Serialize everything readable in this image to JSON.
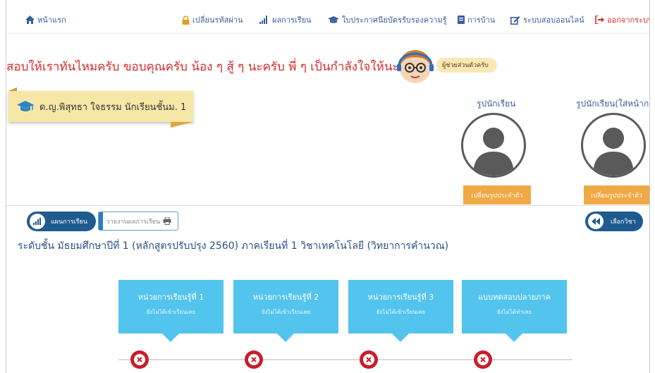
{
  "nav": {
    "home": "หน้าแรก",
    "change_password": "เปลี่ยนรหัสผ่าน",
    "results": "ผลการเรียน",
    "certificate": "ใบประกาศนียบัตรรับรองความรู้",
    "homework": "การบ้าน",
    "online_test": "ระบบสอบออนไลน์",
    "logout": "ออกจากระบบ"
  },
  "marquee": "สอบให้เราทันไหมครับ ขอบคุณครับ น้อง ๆ สู้ ๆ นะครับ พี่ ๆ เป็นกำลังใจให้นะครับ",
  "assistant_label": "ผู้ช่วยส่วนตัวครับ",
  "student": {
    "name": "ด.ญ.พิสุทธา ใจธรรม นักเรียนชั้นม. 1"
  },
  "photos": [
    {
      "title": "รูปนักเรียน",
      "button": "เปลี่ยนรูปประจำตัว"
    },
    {
      "title": "รูปนักเรียน(ใส่หน้ากาก",
      "button": "เปลี่ยนรูปประจำตัว"
    }
  ],
  "buttons": {
    "learning_map": "แผนการเรียน",
    "report": "รายงานผลการเรียน",
    "choose_subject": "เลือกวิชา"
  },
  "course_title": "ระดับชั้น มัธยมศึกษาปีที่ 1 (หลักสูตรปรับปรุง 2560)   ภาคเรียนที่ 1  วิชาเทคโนโลยี (วิทยาการคำนวณ)",
  "units": [
    {
      "title": "หน่วยการเรียนรู้ที่ 1",
      "status": "ยังไม่ได้เข้าเรียนเลย"
    },
    {
      "title": "หน่วยการเรียนรู้ที่ 2",
      "status": "ยังไม่ได้เข้าเรียนเลย"
    },
    {
      "title": "หน่วยการเรียนรู้ที่ 3",
      "status": "ยังไม่ได้เข้าเรียนเลย"
    },
    {
      "title": "แบบทดสอบปลายภาค",
      "status": "ยังไม่ได้ทำเลย"
    }
  ],
  "colors": {
    "nav_text": "#3a5e9c",
    "marquee": "#d62b2b",
    "unit_card": "#52c4ee",
    "photo_button": "#f0a944",
    "pill_button": "#1f5b8f",
    "status_incomplete": "#c81e2c"
  }
}
